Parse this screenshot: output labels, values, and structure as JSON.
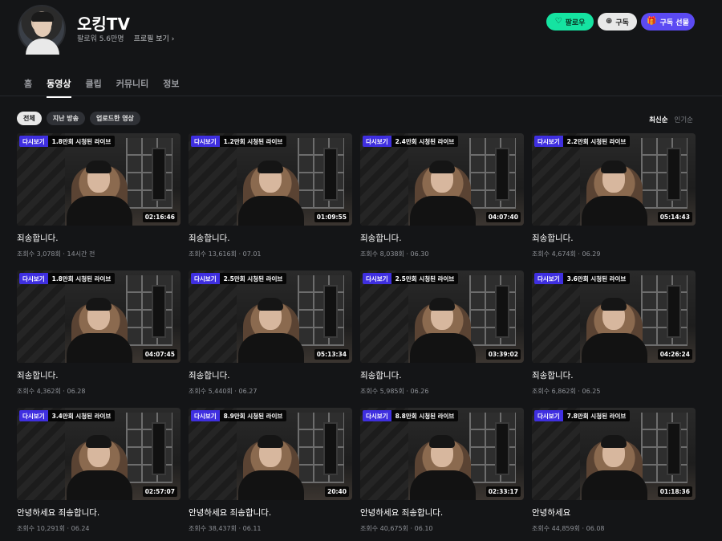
{
  "channel": {
    "name": "오킹TV",
    "followers": "팔로워 5.6만명",
    "profile_link": "프로필 보기 ›",
    "follow_label": "팔로우",
    "subscribe_label": "구독",
    "gift_label": "구독 선물",
    "follow_icon": "♡",
    "subscribe_icon": "⊕",
    "gift_icon": "🎁",
    "accent_follow": "#15e3a1",
    "accent_gift": "#5b4af3"
  },
  "tabs": [
    {
      "label": "홈"
    },
    {
      "label": "동영상"
    },
    {
      "label": "클립"
    },
    {
      "label": "커뮤니티"
    },
    {
      "label": "정보"
    }
  ],
  "active_tab": "동영상",
  "filters": [
    "전체",
    "지난 방송",
    "업로드한 영상"
  ],
  "active_filter": "전체",
  "sort": {
    "latest": "최신순",
    "popular": "인기순"
  },
  "videos": [
    {
      "badge": "다시보기",
      "views_badge": "1.8만회 시청된 라이브",
      "duration": "02:16:46",
      "title": "죄송합니다.",
      "meta": "조회수 3,078회 · 14시간 전"
    },
    {
      "badge": "다시보기",
      "views_badge": "1.2만회 시청된 라이브",
      "duration": "01:09:55",
      "title": "죄송합니다.",
      "meta": "조회수 13,616회 · 07.01"
    },
    {
      "badge": "다시보기",
      "views_badge": "2.4만회 시청된 라이브",
      "duration": "04:07:40",
      "title": "죄송합니다.",
      "meta": "조회수 8,038회 · 06.30"
    },
    {
      "badge": "다시보기",
      "views_badge": "2.2만회 시청된 라이브",
      "duration": "05:14:43",
      "title": "죄송합니다.",
      "meta": "조회수 4,674회 · 06.29"
    },
    {
      "badge": "다시보기",
      "views_badge": "1.8만회 시청된 라이브",
      "duration": "04:07:45",
      "title": "죄송합니다.",
      "meta": "조회수 4,362회 · 06.28"
    },
    {
      "badge": "다시보기",
      "views_badge": "2.5만회 시청된 라이브",
      "duration": "05:13:34",
      "title": "죄송합니다.",
      "meta": "조회수 5,440회 · 06.27"
    },
    {
      "badge": "다시보기",
      "views_badge": "2.5만회 시청된 라이브",
      "duration": "03:39:02",
      "title": "죄송합니다.",
      "meta": "조회수 5,985회 · 06.26"
    },
    {
      "badge": "다시보기",
      "views_badge": "3.6만회 시청된 라이브",
      "duration": "04:26:24",
      "title": "죄송합니다.",
      "meta": "조회수 6,862회 · 06.25"
    },
    {
      "badge": "다시보기",
      "views_badge": "3.4만회 시청된 라이브",
      "duration": "02:57:07",
      "title": "안녕하세요 죄송합니다.",
      "meta": "조회수 10,291회 · 06.24"
    },
    {
      "badge": "다시보기",
      "views_badge": "8.9만회 시청된 라이브",
      "duration": "20:40",
      "title": "안녕하세요 죄송합니다.",
      "meta": "조회수 38,437회 · 06.11"
    },
    {
      "badge": "다시보기",
      "views_badge": "8.8만회 시청된 라이브",
      "duration": "02:33:17",
      "title": "안녕하세요 죄송합니다.",
      "meta": "조회수 40,675회 · 06.10"
    },
    {
      "badge": "다시보기",
      "views_badge": "7.8만회 시청된 라이브",
      "duration": "01:18:36",
      "title": "안녕하세요",
      "meta": "조회수 44,859회 · 06.08"
    }
  ]
}
